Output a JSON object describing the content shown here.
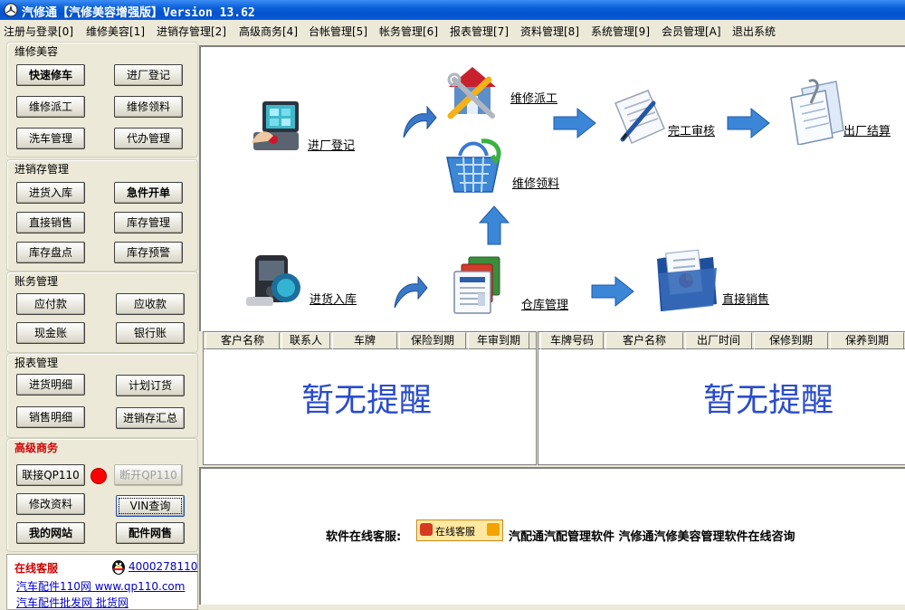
{
  "window": {
    "title": "汽修通【汽修美容增强版】Version 13.62"
  },
  "menu": [
    "注册与登录[0]",
    "维修美容[1]",
    "进销存管理[2]",
    "高级商务[4]",
    "台帐管理[5]",
    "帐务管理[6]",
    "报表管理[7]",
    "资料管理[8]",
    "系统管理[9]",
    "会员管理[A]",
    "退出系统"
  ],
  "sidebar": {
    "repair": {
      "title": "维修美容",
      "buttons": [
        "快速修车",
        "进厂登记",
        "维修派工",
        "维修领料",
        "洗车管理",
        "代办管理"
      ]
    },
    "inventory": {
      "title": "进销存管理",
      "buttons": [
        "进货入库",
        "急件开单",
        "直接销售",
        "库存管理",
        "库存盘点",
        "库存预警"
      ]
    },
    "accounts": {
      "title": "账务管理",
      "buttons": [
        "应付款",
        "应收款",
        "现金账",
        "银行账"
      ]
    },
    "reports": {
      "title": "报表管理",
      "buttons": [
        "进货明细",
        "计划订货",
        "销售明细",
        "进销存汇总"
      ]
    },
    "business": {
      "title": "高级商务",
      "connect": "联接QP110",
      "disconnect": "断开QP110",
      "edit": "修改资料",
      "vin": "VIN查询",
      "site": "我的网站",
      "parts": "配件网售"
    },
    "service": {
      "title": "在线客服",
      "phone": "4000278110",
      "link1": "汽车配件110网 www.qp110.com",
      "link2": "汽车配件批发网 批货网"
    }
  },
  "flow": {
    "checkin": "进厂登记",
    "dispatch": "维修派工",
    "review": "完工审核",
    "checkout": "出厂结算",
    "pick": "维修领料",
    "purchase": "进货入库",
    "warehouse": "仓库管理",
    "sales": "直接销售"
  },
  "table_left": {
    "columns": [
      "客户名称",
      "联系人",
      "车牌",
      "保险到期",
      "年审到期"
    ],
    "empty": "暂无提醒"
  },
  "table_right": {
    "columns": [
      "车牌号码",
      "客户名称",
      "出厂时间",
      "保修到期",
      "保养到期"
    ],
    "empty": "暂无提醒"
  },
  "footer": {
    "label": "软件在线客服:",
    "button": "在线客服",
    "promo": "汽配通汽配管理软件 汽修通汽修美容管理软件在线咨询"
  },
  "colors": {
    "titlebar": "#0451cc",
    "panel": "#ece9d8",
    "emptyText": "#2a4ccc",
    "link": "#0000cc",
    "accentRed": "#d00000"
  }
}
